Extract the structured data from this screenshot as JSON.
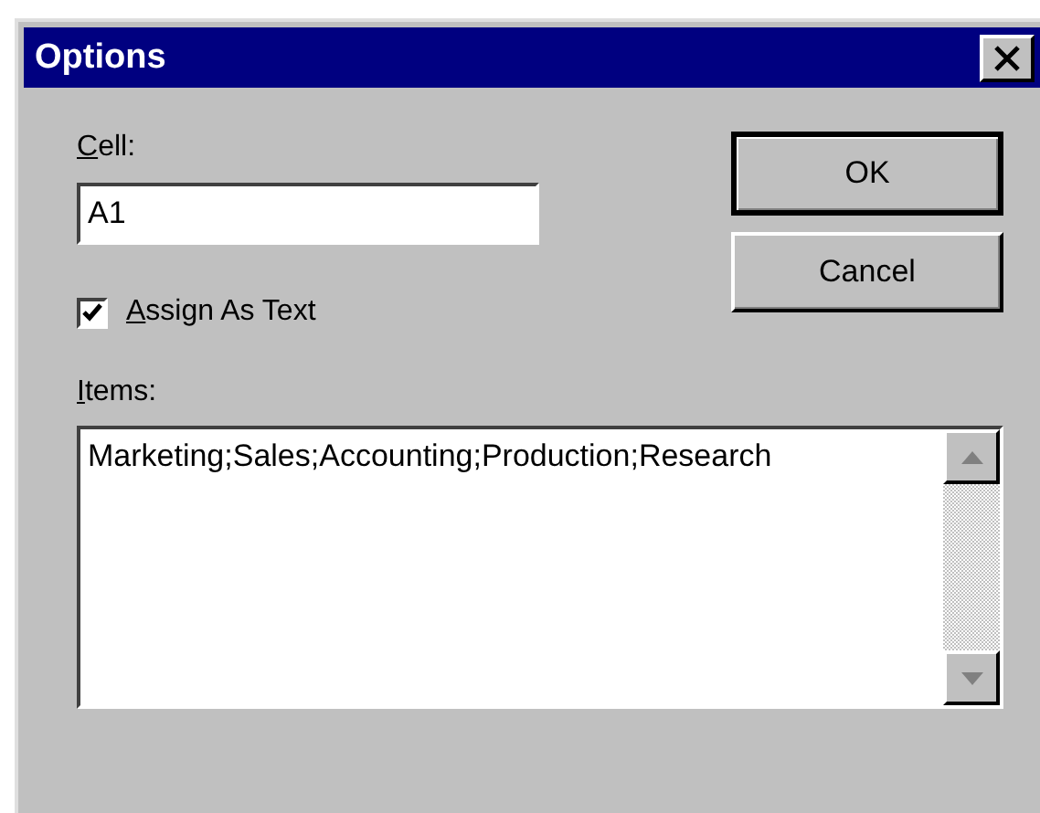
{
  "window": {
    "title": "Options"
  },
  "cell": {
    "label": "Cell:",
    "value": "A1"
  },
  "assign_as_text": {
    "label": "Assign As Text",
    "checked": true
  },
  "items": {
    "label": "Items:",
    "value": "Marketing;Sales;Accounting;Production;Research"
  },
  "buttons": [
    {
      "label": "OK",
      "default": true
    },
    {
      "label": "Cancel",
      "default": false
    }
  ]
}
